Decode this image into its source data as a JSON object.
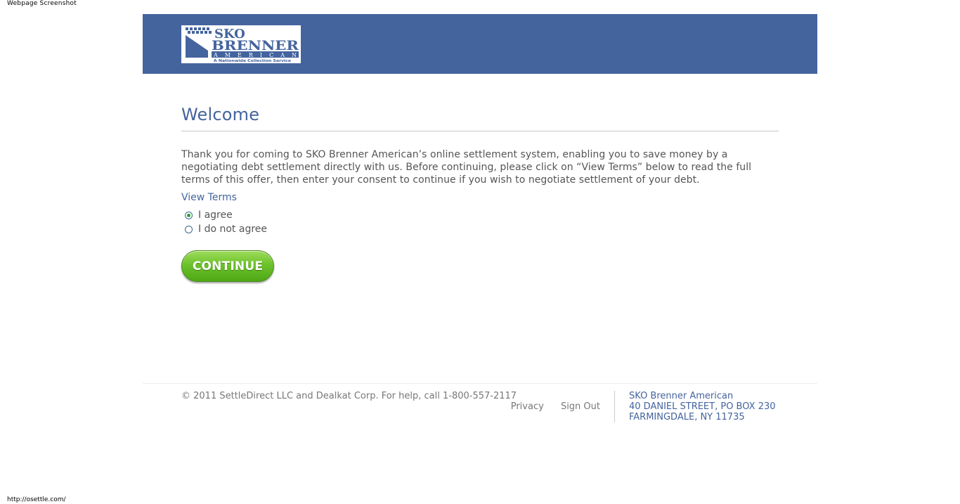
{
  "screenshot_label": "Webpage Screenshot",
  "url_label": "http://osettle.com/",
  "header": {
    "brand_color": "#44649e",
    "logo": {
      "line1": "SKO",
      "line2": "BRENNER",
      "line3": "AMERICAN",
      "tagline": "A Nationwide Collection Service"
    }
  },
  "main": {
    "title": "Welcome",
    "intro": "Thank you for coming to SKO Brenner American’s online settlement system, enabling you to save money by a negotiating debt settlement directly with us. Before continuing, please click on “View Terms” below to read the full terms of this offer, then enter your consent to continue if you wish to negotiate settlement of your debt.",
    "view_terms": "View Terms",
    "options": [
      {
        "label": "I agree",
        "checked": true
      },
      {
        "label": "I do not agree",
        "checked": false
      }
    ],
    "continue_label": "CONTINUE",
    "continue_color": "#6cc22b"
  },
  "footer": {
    "copyright": "© 2011 SettleDirect LLC and Dealkat Corp. For help, call 1-800-557-2117",
    "links": {
      "privacy": "Privacy",
      "sign_out": "Sign Out"
    },
    "address": {
      "company": "SKO Brenner American",
      "street": "40 DANIEL STREET, PO BOX 230",
      "city": "FARMINGDALE, NY 11735"
    }
  }
}
